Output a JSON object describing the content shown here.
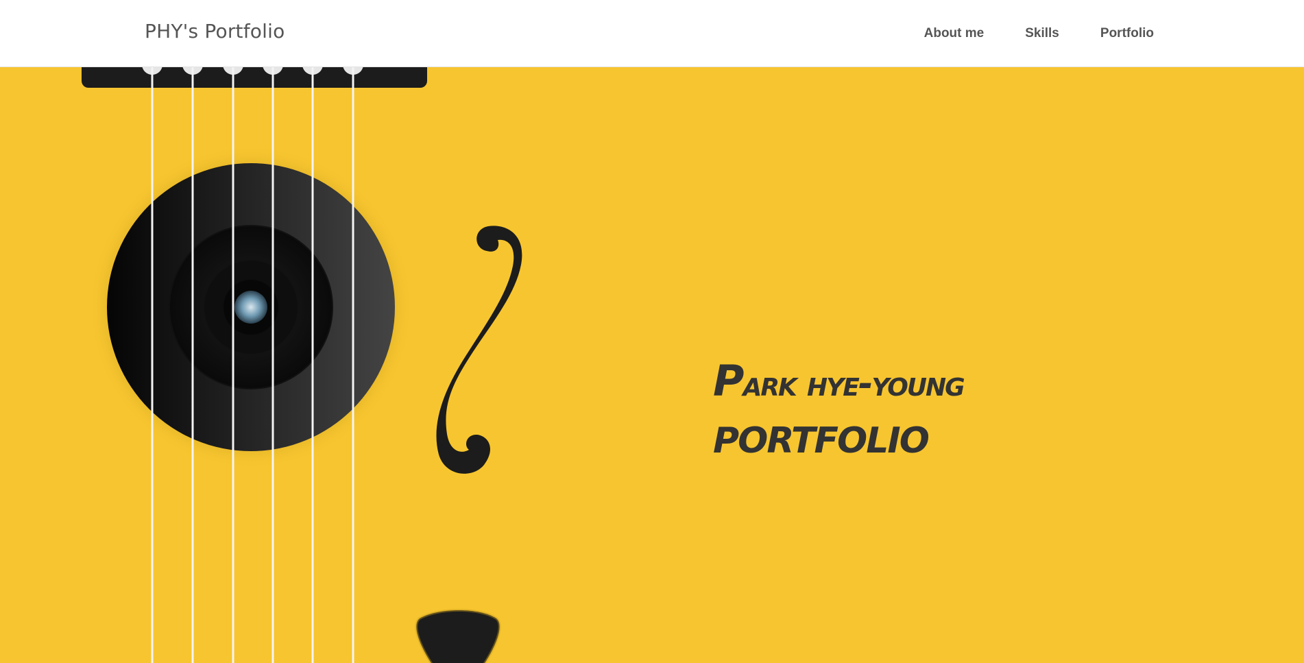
{
  "header": {
    "brand": "PHY's Portfolio",
    "nav": [
      {
        "label": "About me"
      },
      {
        "label": "Skills"
      },
      {
        "label": "Portfolio"
      }
    ]
  },
  "hero": {
    "title_first_letter": "P",
    "title_line1_rest": "ark hye-young",
    "title_line2": "PORTFOLIO"
  },
  "colors": {
    "background": "#f7c52f",
    "header_bg": "#ffffff",
    "text_dark": "#333333",
    "nav_text": "#555555",
    "guitar_black": "#1a1a1a"
  },
  "icons": [
    "guitar-sound-hole-icon",
    "f-hole-icon",
    "guitar-pick-icon"
  ]
}
